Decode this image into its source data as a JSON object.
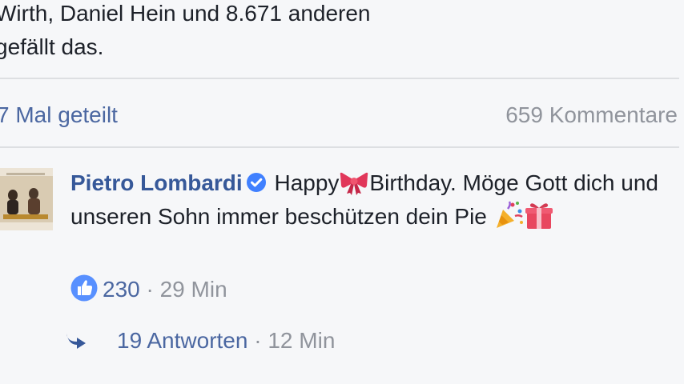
{
  "post_footer": {
    "likes_line1": "Wirth, Daniel Hein und 8.671 anderen",
    "likes_line2": "gefällt das.",
    "shares": "7 Mal geteilt",
    "comments_count": "659 Kommentare"
  },
  "comment": {
    "author": "Pietro Lombardi",
    "text_part1": "Happy",
    "text_part2": "Birthday. Möge Gott dich und unseren Sohn immer beschützen dein Pie",
    "likes": "230",
    "separator": " · ",
    "time": "29 Min",
    "emojis": [
      "ribbon-emoji",
      "party-popper-emoji",
      "gift-emoji"
    ],
    "avatar_icon": "profile-photo"
  },
  "replies": {
    "label": "19 Antworten",
    "separator": " · ",
    "time": "12 Min",
    "icon": "reply-arrow-icon"
  },
  "colors": {
    "link_blue": "#365899",
    "meta_gray": "#90949c",
    "background": "#f6f7f9",
    "like_blue": "#5890ff",
    "verified_blue": "#4080ff"
  }
}
